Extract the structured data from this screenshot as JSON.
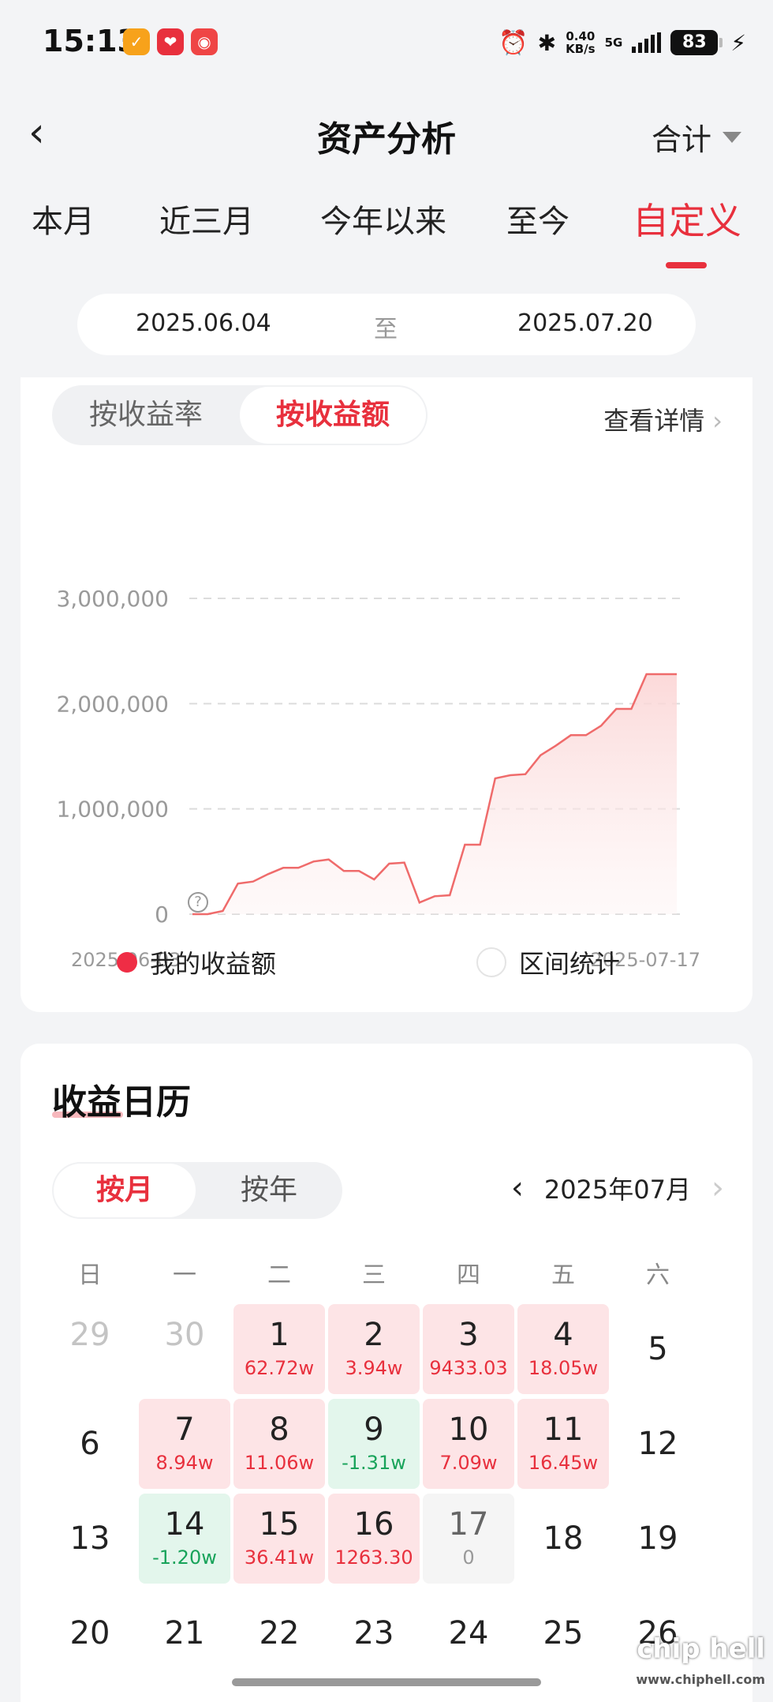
{
  "status": {
    "time": "15:13",
    "net_speed": "0.40",
    "net_unit": "KB/s",
    "network": "5G",
    "battery": "83",
    "colors": {
      "app1": "#f7a21b",
      "app2": "#e8303d",
      "app3": "#ef4545"
    }
  },
  "nav": {
    "title": "资产分析",
    "right_label": "合计"
  },
  "tabs": [
    "本月",
    "近三月",
    "今年以来",
    "至今",
    "自定义"
  ],
  "range": {
    "start": "2025.06.04",
    "sep": "至",
    "end": "2025.07.20"
  },
  "chart_card": {
    "toggle": [
      "按收益率",
      "按收益额"
    ],
    "detail": "查看详情",
    "legend": [
      "我的收益额",
      "区间统计"
    ]
  },
  "chart_data": {
    "type": "area",
    "x_start": "2025-06-03",
    "x_end": "2025-07-17",
    "y_ticks": [
      "3,000,000",
      "2,000,000",
      "1,000,000",
      "0"
    ],
    "ylim": [
      0,
      3000000
    ],
    "values": [
      0,
      0,
      30000,
      290000,
      310000,
      380000,
      440000,
      440000,
      500000,
      520000,
      410000,
      410000,
      330000,
      480000,
      490000,
      110000,
      170000,
      180000,
      660000,
      660000,
      1290000,
      1320000,
      1330000,
      1510000,
      1600000,
      1700000,
      1700000,
      1790000,
      1950000,
      1950000,
      2280000,
      2280000,
      2280000
    ],
    "color": "#ef6b6b",
    "grid": true
  },
  "calendar": {
    "title": "收益日历",
    "toggle": [
      "按月",
      "按年"
    ],
    "month": "2025年07月",
    "weekdays": [
      "日",
      "一",
      "二",
      "三",
      "四",
      "五",
      "六"
    ],
    "rows": [
      [
        {
          "d": "29",
          "t": "dim"
        },
        {
          "d": "30",
          "t": "dim"
        },
        {
          "d": "1",
          "v": "62.72w",
          "t": "pos"
        },
        {
          "d": "2",
          "v": "3.94w",
          "t": "pos"
        },
        {
          "d": "3",
          "v": "9433.03",
          "t": "pos"
        },
        {
          "d": "4",
          "v": "18.05w",
          "t": "pos"
        },
        {
          "d": "5",
          "t": "plain"
        }
      ],
      [
        {
          "d": "6",
          "t": "plain"
        },
        {
          "d": "7",
          "v": "8.94w",
          "t": "pos"
        },
        {
          "d": "8",
          "v": "11.06w",
          "t": "pos"
        },
        {
          "d": "9",
          "v": "-1.31w",
          "t": "neg"
        },
        {
          "d": "10",
          "v": "7.09w",
          "t": "pos"
        },
        {
          "d": "11",
          "v": "16.45w",
          "t": "pos"
        },
        {
          "d": "12",
          "t": "plain"
        }
      ],
      [
        {
          "d": "13",
          "t": "plain"
        },
        {
          "d": "14",
          "v": "-1.20w",
          "t": "neg"
        },
        {
          "d": "15",
          "v": "36.41w",
          "t": "pos"
        },
        {
          "d": "16",
          "v": "1263.30",
          "t": "pos"
        },
        {
          "d": "17",
          "v": "0",
          "t": "zero"
        },
        {
          "d": "18",
          "t": "plain"
        },
        {
          "d": "19",
          "t": "plain"
        }
      ],
      [
        {
          "d": "20",
          "t": "plain"
        },
        {
          "d": "21",
          "t": "plain"
        },
        {
          "d": "22",
          "t": "plain"
        },
        {
          "d": "23",
          "t": "plain"
        },
        {
          "d": "24",
          "t": "plain"
        },
        {
          "d": "25",
          "t": "plain"
        },
        {
          "d": "26",
          "t": "plain"
        }
      ]
    ]
  },
  "watermark": {
    "logo": "chip hell",
    "url": "www.chiphell.com"
  }
}
